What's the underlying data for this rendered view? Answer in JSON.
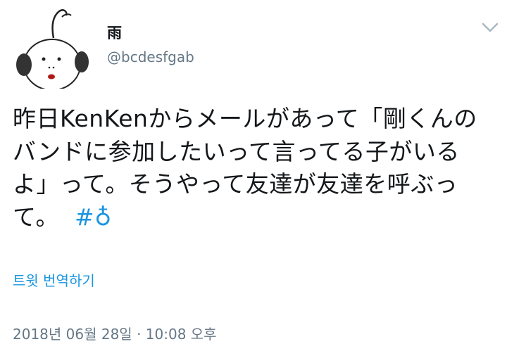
{
  "user": {
    "display_name": "雨",
    "handle": "@bcdesfgab"
  },
  "icons": {
    "menu": "chevron-down-icon",
    "avatar": "cartoon-face-avatar"
  },
  "tweet": {
    "lines": [
      "昨日KenKenからメールがあって「剛くんの",
      "バンドに参加したいって言ってる子がいる",
      "よ」って。そうやって友達が友達を呼ぶっ",
      "て。"
    ],
    "hashtag": "#♁"
  },
  "translate_label": "트윗 번역하기",
  "timestamp": "2018년 06월 28일 · 10:08 오후",
  "colors": {
    "link": "#1b95e0",
    "muted": "#657786",
    "text": "#14171a"
  }
}
